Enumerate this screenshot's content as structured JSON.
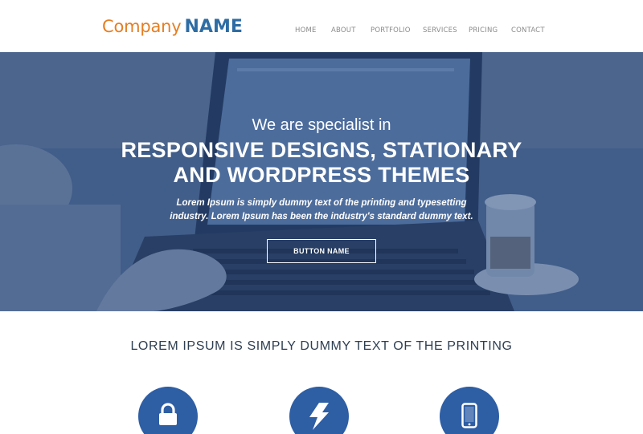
{
  "header": {
    "logo_light": "Company",
    "logo_bold": "NAME",
    "nav": [
      {
        "label": "HOME"
      },
      {
        "label": "ABOUT"
      },
      {
        "label": "PORTFOLIO"
      },
      {
        "label": "SERVICES"
      },
      {
        "label": "PRICING"
      },
      {
        "label": "CONTACT"
      }
    ]
  },
  "hero": {
    "subtitle": "We are specialist in",
    "title_line1": "RESPONSIVE DESIGNS, STATIONARY",
    "title_line2": "AND WORDPRESS THEMES",
    "desc_line1": "Lorem Ipsum is simply dummy text of the printing and typesetting",
    "desc_line2": "industry. Lorem Ipsum has been the industry's standard dummy text.",
    "button_label": "BUTTON NAME"
  },
  "section": {
    "title": "LOREM IPSUM IS SIMPLY DUMMY TEXT OF THE PRINTING",
    "features": [
      {
        "icon": "lock-icon"
      },
      {
        "icon": "lightning-icon"
      },
      {
        "icon": "mobile-phone-icon"
      }
    ]
  },
  "colors": {
    "logo_light": "#e67e22",
    "logo_bold": "#2e6da4",
    "feature_circle": "#2e5ea4",
    "hero_tint": "#2a4a80"
  }
}
